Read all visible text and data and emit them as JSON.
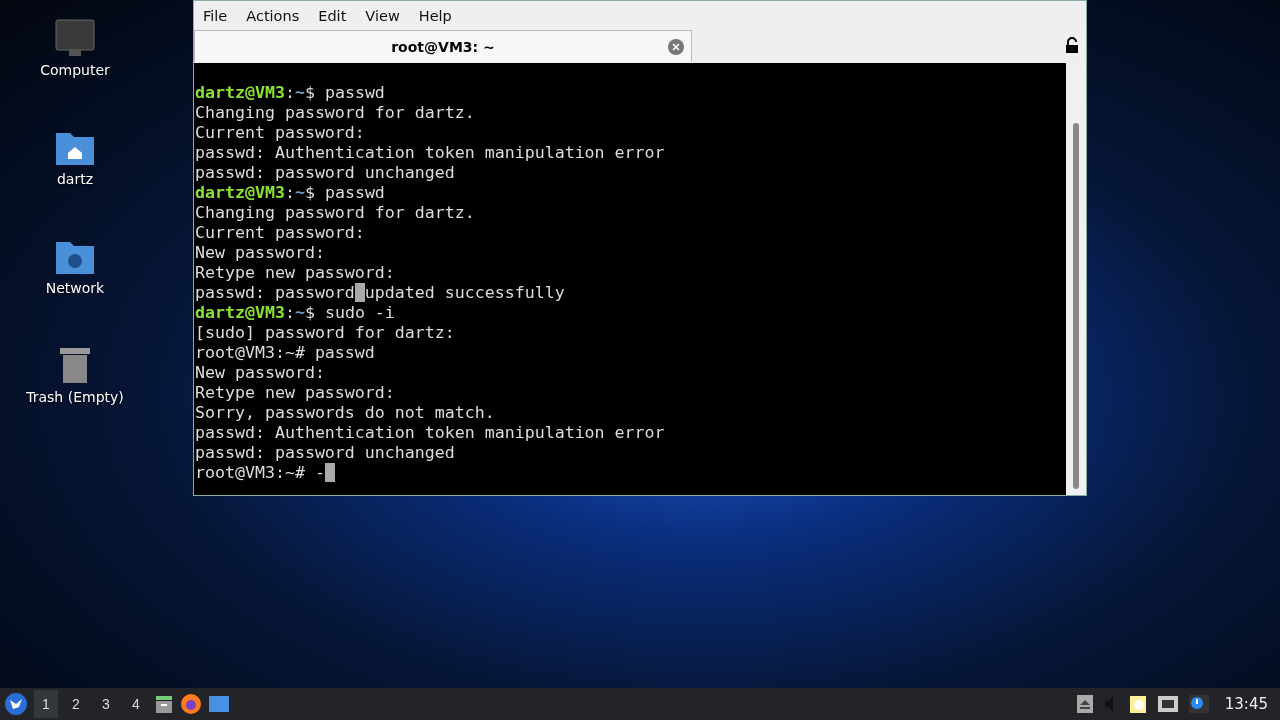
{
  "desktop_icons": [
    {
      "label": "Computer",
      "kind": "computer"
    },
    {
      "label": "dartz",
      "kind": "home"
    },
    {
      "label": "Network",
      "kind": "network"
    },
    {
      "label": "Trash (Empty)",
      "kind": "trash"
    }
  ],
  "window": {
    "menu": [
      "File",
      "Actions",
      "Edit",
      "View",
      "Help"
    ],
    "tabs": [
      {
        "title": "root@VM3: ~",
        "selected": true
      }
    ],
    "lines": [
      {
        "kind": "prompt",
        "user": "dartz@VM3",
        "separator": ":",
        "path": "~",
        "symbol": "$",
        "command": "passwd"
      },
      {
        "kind": "output",
        "text": "Changing password for dartz."
      },
      {
        "kind": "output",
        "text": "Current password:"
      },
      {
        "kind": "output",
        "text": "passwd: Authentication token manipulation error"
      },
      {
        "kind": "output",
        "text": "passwd: password unchanged"
      },
      {
        "kind": "prompt",
        "user": "dartz@VM3",
        "separator": ":",
        "path": "~",
        "symbol": "$",
        "command": "passwd"
      },
      {
        "kind": "output",
        "text": "Changing password for dartz."
      },
      {
        "kind": "output",
        "text": "Current password:"
      },
      {
        "kind": "output",
        "text": "New password:"
      },
      {
        "kind": "output",
        "text": "Retype new password:"
      },
      {
        "kind": "output",
        "text": "passwd: password",
        "block_then": "updated successfully"
      },
      {
        "kind": "prompt",
        "user": "dartz@VM3",
        "separator": ":",
        "path": "~",
        "symbol": "$",
        "command": "sudo -i"
      },
      {
        "kind": "output",
        "text": "[sudo] password for dartz:"
      },
      {
        "kind": "output",
        "text": "root@VM3:~# passwd"
      },
      {
        "kind": "output",
        "text": "New password:"
      },
      {
        "kind": "output",
        "text": "Retype new password:"
      },
      {
        "kind": "output",
        "text": "Sorry, passwords do not match."
      },
      {
        "kind": "output",
        "text": "passwd: Authentication token manipulation error"
      },
      {
        "kind": "output",
        "text": "passwd: password unchanged"
      },
      {
        "kind": "output",
        "text": "root@VM3:~# -",
        "cursor": true
      }
    ]
  },
  "taskbar": {
    "workspaces": [
      {
        "label": "1",
        "selected": true
      },
      {
        "label": "2",
        "selected": false
      },
      {
        "label": "3",
        "selected": false
      },
      {
        "label": "4",
        "selected": false
      }
    ],
    "clock": "13:45"
  }
}
